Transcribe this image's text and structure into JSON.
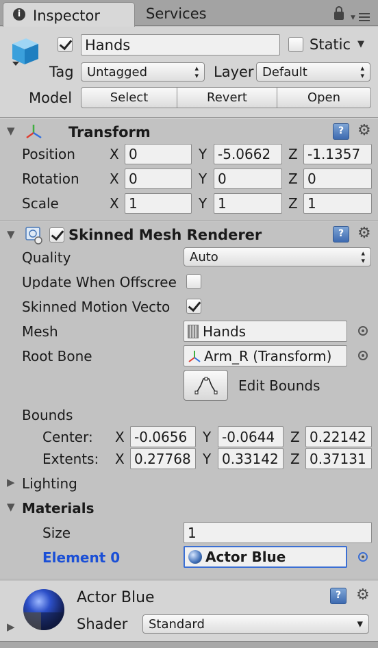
{
  "tabs": {
    "inspector": "Inspector",
    "services": "Services"
  },
  "header": {
    "object_name": "Hands",
    "active": true,
    "static_label": "Static",
    "static_checked": false,
    "tag_label": "Tag",
    "tag_value": "Untagged",
    "layer_label": "Layer",
    "layer_value": "Default",
    "model_label": "Model",
    "model_buttons": {
      "select": "Select",
      "revert": "Revert",
      "open": "Open"
    }
  },
  "transform": {
    "title": "Transform",
    "axis": {
      "x": "X",
      "y": "Y",
      "z": "Z"
    },
    "position": {
      "label": "Position",
      "x": "0",
      "y": "-5.0662",
      "z": "-1.1357"
    },
    "rotation": {
      "label": "Rotation",
      "x": "0",
      "y": "0",
      "z": "0"
    },
    "scale": {
      "label": "Scale",
      "x": "1",
      "y": "1",
      "z": "1"
    }
  },
  "renderer": {
    "title": "Skinned Mesh Renderer",
    "enabled": true,
    "quality_label": "Quality",
    "quality_value": "Auto",
    "update_offscreen_label": "Update When Offscree",
    "update_offscreen_checked": false,
    "motion_vectors_label": "Skinned Motion Vecto",
    "motion_vectors_checked": true,
    "mesh_label": "Mesh",
    "mesh_value": "Hands",
    "root_bone_label": "Root Bone",
    "root_bone_value": "Arm_R (Transform)",
    "edit_bounds_label": "Edit Bounds",
    "bounds_label": "Bounds",
    "center": {
      "label": "Center:",
      "x": "-0.0656",
      "y": "-0.0644",
      "z": "0.22142"
    },
    "extents": {
      "label": "Extents:",
      "x": "0.27768",
      "y": "0.33142",
      "z": "0.37131"
    },
    "lighting_label": "Lighting",
    "materials_label": "Materials",
    "size_label": "Size",
    "size_value": "1",
    "element0_label": "Element 0",
    "element0_value": "Actor Blue"
  },
  "material": {
    "name": "Actor Blue",
    "shader_label": "Shader",
    "shader_value": "Standard"
  },
  "colors": {
    "accent_blue": "#1a4fd6",
    "panel_bg": "#c2c2c2"
  }
}
